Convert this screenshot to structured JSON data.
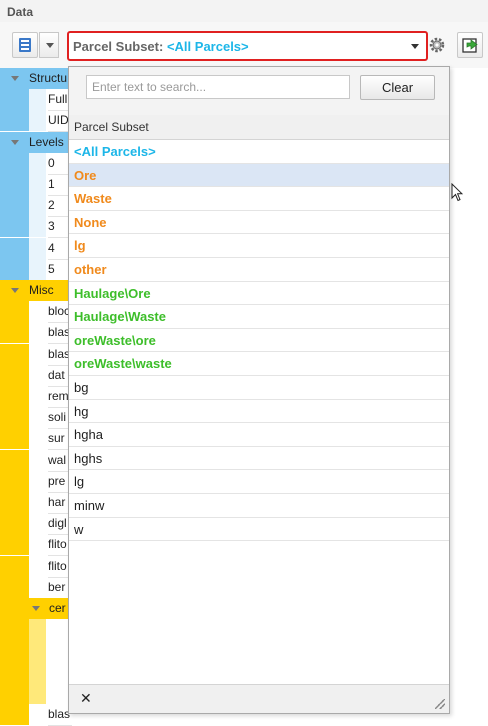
{
  "panel": {
    "title": "Data"
  },
  "toolbar": {
    "subset_label": "Parcel Subset:",
    "subset_value": "<All Parcels>"
  },
  "colors": {
    "cyan": "#1cb6e8",
    "orange": "#f08a1c",
    "green": "#3dbe2a",
    "black": "#1e1e1e",
    "highlight": "#e02020"
  },
  "tree": {
    "groups": [
      {
        "label": "Structu",
        "color": "#7cc6f0",
        "children": [
          "Full",
          "UID"
        ]
      },
      {
        "label": "Levels",
        "color": "#7cc6f0",
        "children": [
          "0",
          "1",
          "2",
          "3",
          "4",
          "5"
        ]
      },
      {
        "label": "Misc",
        "color": "#ffd000",
        "children": [
          "bloc",
          "blas",
          "blas",
          "dat",
          "rem",
          "soli",
          "sur",
          "wal",
          "pre",
          "har",
          "digl",
          "flito",
          "flito",
          "ber"
        ]
      },
      {
        "label": "cer",
        "color": "#ffd000",
        "children": []
      }
    ],
    "last_row": "blas"
  },
  "popup": {
    "search_placeholder": "Enter text to search...",
    "search_value": "",
    "clear_label": "Clear",
    "header": "Parcel Subset",
    "close_label": "✕",
    "items": [
      {
        "label": "<All Parcels>",
        "color": "cyan",
        "bold": true,
        "selected": false
      },
      {
        "label": "Ore",
        "color": "orange",
        "bold": true,
        "selected": true
      },
      {
        "label": "Waste",
        "color": "orange",
        "bold": true,
        "selected": false
      },
      {
        "label": "None",
        "color": "orange",
        "bold": true,
        "selected": false
      },
      {
        "label": "lg",
        "color": "orange",
        "bold": true,
        "selected": false
      },
      {
        "label": "other",
        "color": "orange",
        "bold": true,
        "selected": false
      },
      {
        "label": "Haulage\\Ore",
        "color": "green",
        "bold": true,
        "selected": false
      },
      {
        "label": "Haulage\\Waste",
        "color": "green",
        "bold": true,
        "selected": false
      },
      {
        "label": "oreWaste\\ore",
        "color": "green",
        "bold": true,
        "selected": false
      },
      {
        "label": "oreWaste\\waste",
        "color": "green",
        "bold": true,
        "selected": false
      },
      {
        "label": "bg",
        "color": "black",
        "bold": false,
        "selected": false
      },
      {
        "label": "hg",
        "color": "black",
        "bold": false,
        "selected": false
      },
      {
        "label": "hgha",
        "color": "black",
        "bold": false,
        "selected": false
      },
      {
        "label": "hghs",
        "color": "black",
        "bold": false,
        "selected": false
      },
      {
        "label": "lg",
        "color": "black",
        "bold": false,
        "selected": false
      },
      {
        "label": "minw",
        "color": "black",
        "bold": false,
        "selected": false
      },
      {
        "label": "w",
        "color": "black",
        "bold": false,
        "selected": false
      }
    ]
  }
}
